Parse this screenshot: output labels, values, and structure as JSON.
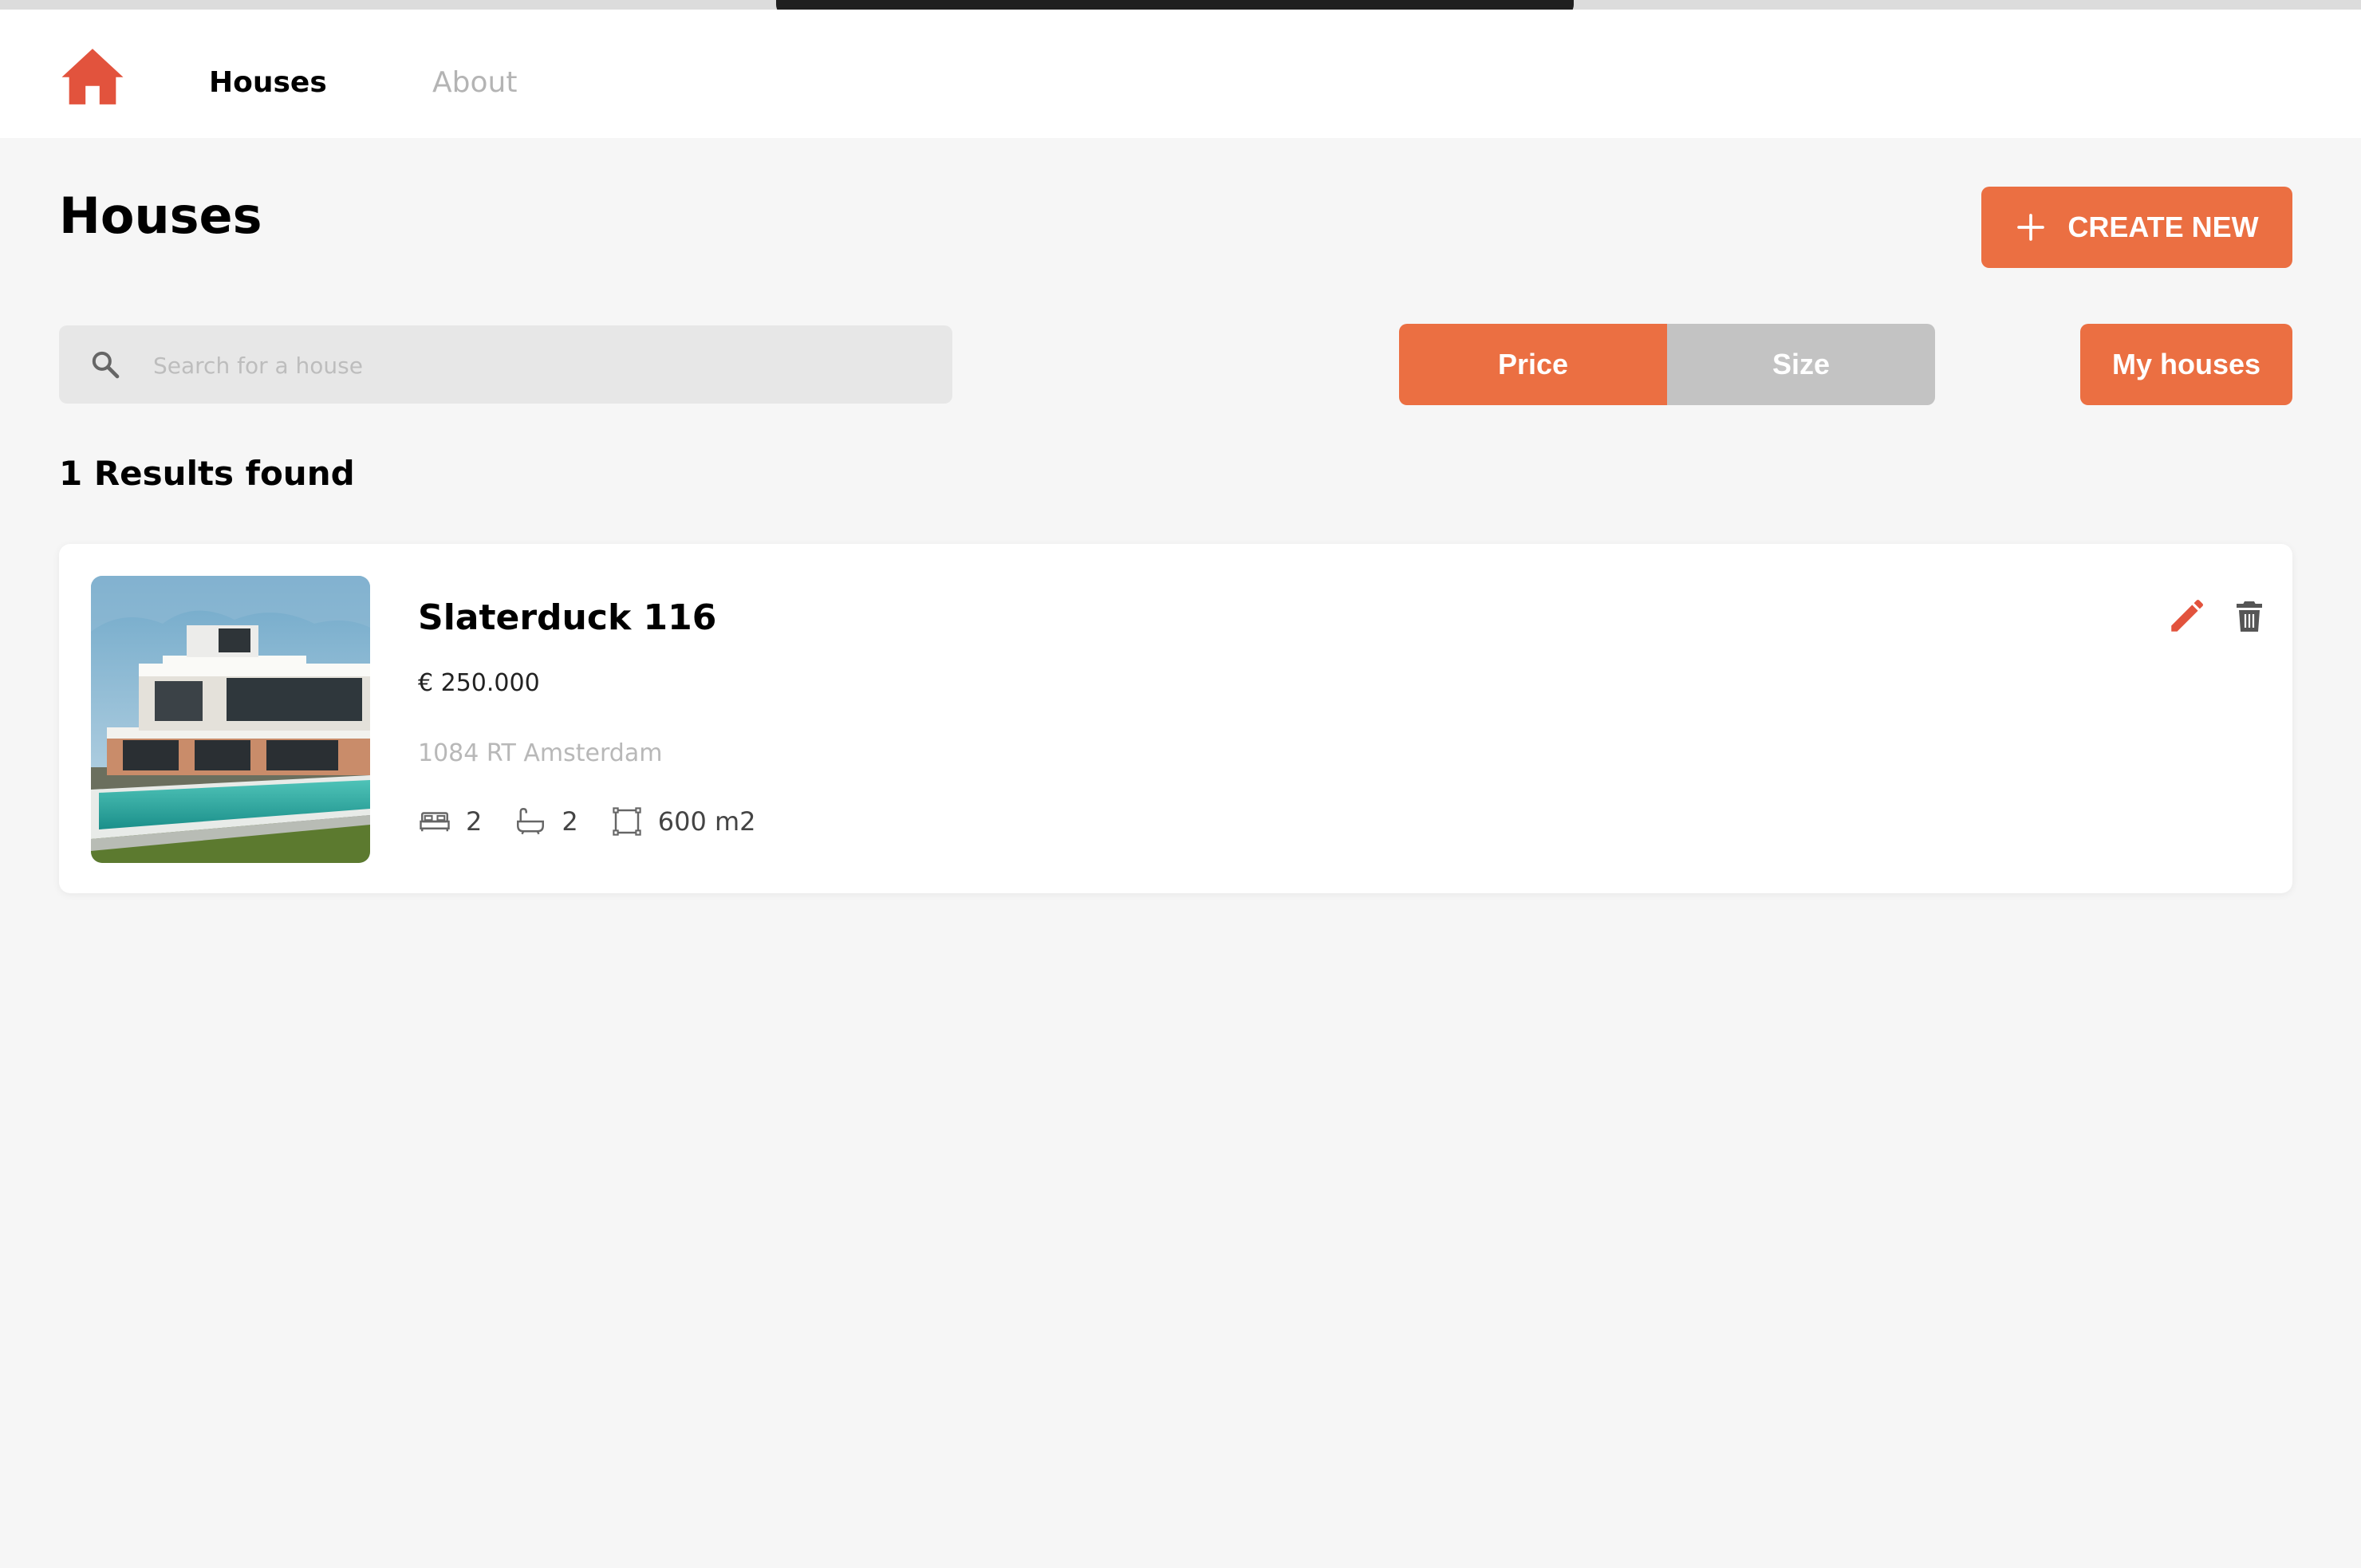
{
  "nav": {
    "logo_icon": "home-icon",
    "links": [
      {
        "label": "Houses",
        "active": true
      },
      {
        "label": "About",
        "active": false
      }
    ]
  },
  "page": {
    "title": "Houses",
    "create_label": "CREATE NEW",
    "create_icon": "plus-icon"
  },
  "search": {
    "placeholder": "Search for a house",
    "value": "",
    "icon": "search-icon"
  },
  "sort": {
    "options": [
      "Price",
      "Size"
    ],
    "selected": "Price"
  },
  "my_houses_label": "My houses",
  "results": {
    "count_text": "1 Results found"
  },
  "listings": [
    {
      "title": "Slaterduck 116",
      "price": "€ 250.000",
      "address": "1084 RT Amsterdam",
      "bedrooms": "2",
      "bathrooms": "2",
      "size": "600 m2"
    }
  ],
  "colors": {
    "accent": "#eb6f42",
    "logo": "#e2533d",
    "edit_icon": "#e2533d",
    "inactive_sort": "#c3c3c3",
    "background": "#f6f6f6"
  }
}
